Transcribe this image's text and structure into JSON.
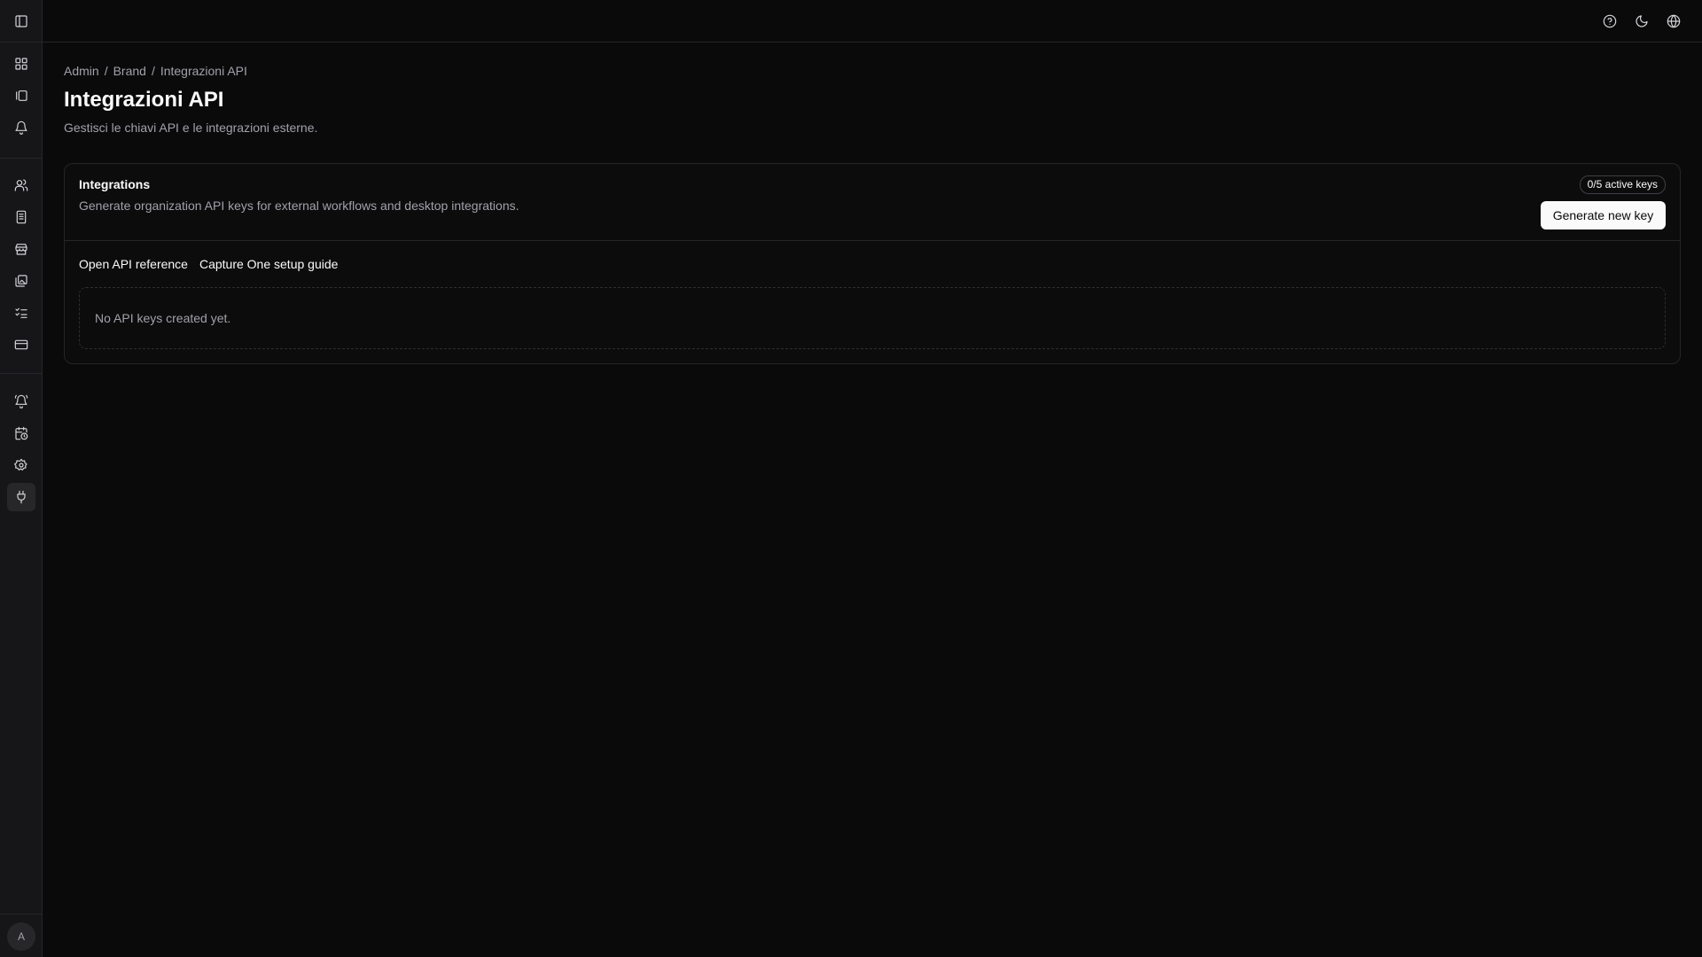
{
  "sidebar": {
    "items": [
      {
        "name": "dashboard-icon"
      },
      {
        "name": "gallery-icon"
      },
      {
        "name": "notifications-icon"
      },
      {
        "name": "users-icon"
      },
      {
        "name": "building-icon"
      },
      {
        "name": "store-icon"
      },
      {
        "name": "images-icon"
      },
      {
        "name": "checklist-icon"
      },
      {
        "name": "credit-card-icon"
      },
      {
        "name": "bell-alert-icon"
      },
      {
        "name": "calendar-clock-icon"
      },
      {
        "name": "settings-icon"
      },
      {
        "name": "plug-icon"
      }
    ],
    "active": "plug-icon",
    "avatar_initial": "A"
  },
  "topbar": {
    "icons": [
      "help-icon",
      "moon-icon",
      "globe-icon"
    ]
  },
  "breadcrumb": {
    "items": [
      "Admin",
      "Brand",
      "Integrazioni API"
    ],
    "separator": "/"
  },
  "page": {
    "title": "Integrazioni API",
    "description": "Gestisci le chiavi API e le integrazioni esterne."
  },
  "card": {
    "title": "Integrations",
    "description": "Generate organization API keys for external workflows and desktop integrations.",
    "badge": "0/5 active keys",
    "generate_button": "Generate new key",
    "links": [
      "Open API reference",
      "Capture One setup guide"
    ],
    "empty_text": "No API keys created yet."
  },
  "colors": {
    "background": "#0a0a0b",
    "border": "#26262a",
    "text": "#fafafa",
    "muted": "#a1a1aa"
  }
}
